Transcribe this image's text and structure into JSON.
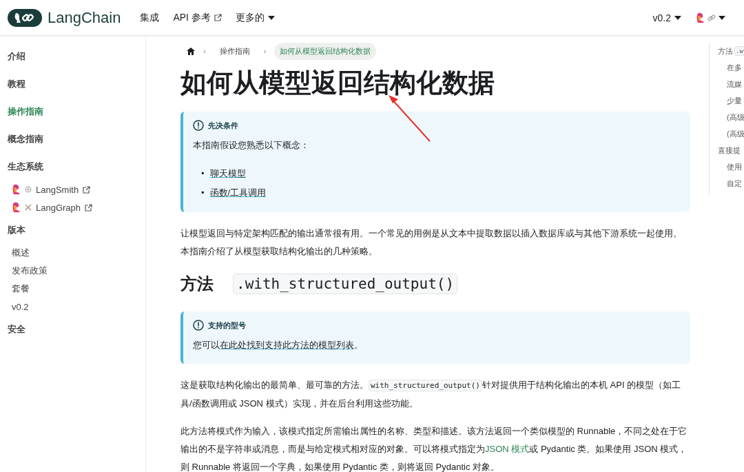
{
  "header": {
    "brand": "LangChain",
    "nav": [
      {
        "label": "集成",
        "kind": "plain"
      },
      {
        "label": "API 参考",
        "kind": "external"
      },
      {
        "label": "更多的",
        "kind": "dropdown"
      }
    ],
    "version": "v0.2"
  },
  "sidebar": {
    "items": [
      {
        "label": "介绍",
        "kind": "category",
        "selected": false
      },
      {
        "label": "教程",
        "kind": "category",
        "selected": false
      },
      {
        "label": "操作指南",
        "kind": "category",
        "selected": true
      },
      {
        "label": "概念指南",
        "kind": "category",
        "selected": false
      },
      {
        "label": "生态系统",
        "kind": "heading",
        "selected": false
      },
      {
        "label": "LangSmith",
        "kind": "ecosystem",
        "selected": false
      },
      {
        "label": "LangGraph",
        "kind": "ecosystem",
        "selected": false
      },
      {
        "label": "版本",
        "kind": "heading",
        "selected": false
      },
      {
        "label": "概述",
        "kind": "sub",
        "selected": false
      },
      {
        "label": "发布政策",
        "kind": "sub",
        "selected": false
      },
      {
        "label": "套餐",
        "kind": "sub",
        "selected": false
      },
      {
        "label": "v0.2",
        "kind": "sub",
        "selected": false
      },
      {
        "label": "安全",
        "kind": "category",
        "selected": false
      }
    ]
  },
  "breadcrumb_separator": "›",
  "breadcrumb": [
    {
      "label": "操作指南",
      "selected": false
    },
    {
      "label": "如何从模型返回结构化数据",
      "selected": true
    }
  ],
  "title": "如何从模型返回结构化数据",
  "content": [
    {
      "kind": "admonition",
      "title": "先决条件",
      "text": "本指南假设您熟悉以下概念：",
      "bullet": "•",
      "links": [
        "聊天模型",
        "函数/工具调用"
      ]
    },
    {
      "kind": "paragraph",
      "segments": [
        {
          "kind": "text",
          "text": "让模型返回与特定架构匹配的输出通常很有用。一个常见的用例是从文本中提取数据以插入数据库或与其他下游系统一起使用。本指南介绍了从模型获取结构化输出的几种策略。"
        }
      ]
    },
    {
      "kind": "heading",
      "text": "方法",
      "code": ".with_structured_output()"
    },
    {
      "kind": "admonition",
      "title": "支持的型号",
      "segments": [
        {
          "kind": "text",
          "text": "您可以"
        },
        {
          "kind": "link",
          "text": "在此处找到支持此方法的模型列表"
        },
        {
          "kind": "text",
          "text": "。"
        }
      ]
    },
    {
      "kind": "paragraph",
      "segments": [
        {
          "kind": "text",
          "text": "这是获取结构化输出的最简单、最可靠的方法。"
        },
        {
          "kind": "code",
          "text": "with_structured_output()"
        },
        {
          "kind": "text",
          "text": "针对提供用于结构化输出的本机 API 的模型（如工具/函数调用或 JSON 模式）实现，并在后台利用这些功能。"
        }
      ]
    },
    {
      "kind": "paragraph",
      "segments": [
        {
          "kind": "text",
          "text": "此方法将模式作为输入，该模式指定所需输出属性的名称、类型和描述。该方法返回一个类似模型的 Runnable，不同之处在于它输出的不是字符串或消息，而是与给定模式相对应的对象。可以将模式指定为"
        },
        {
          "kind": "greenlink",
          "text": "JSON 模式"
        },
        {
          "kind": "text",
          "text": "或 Pydantic 类。如果使用 JSON 模式，则 Runnable 将返回一个字典，如果使用 Pydantic 类，则将返回 Pydantic 对象。"
        }
      ]
    }
  ],
  "toc": [
    {
      "label": "方法",
      "code": ".w",
      "children": [
        {
          "label": "在多"
        },
        {
          "label": "流媒"
        },
        {
          "label": "少量"
        },
        {
          "label": "(高级"
        },
        {
          "label": "(高级"
        }
      ]
    },
    {
      "label": "直接提",
      "children": [
        {
          "label": "使用"
        },
        {
          "label": "自定"
        }
      ]
    }
  ]
}
